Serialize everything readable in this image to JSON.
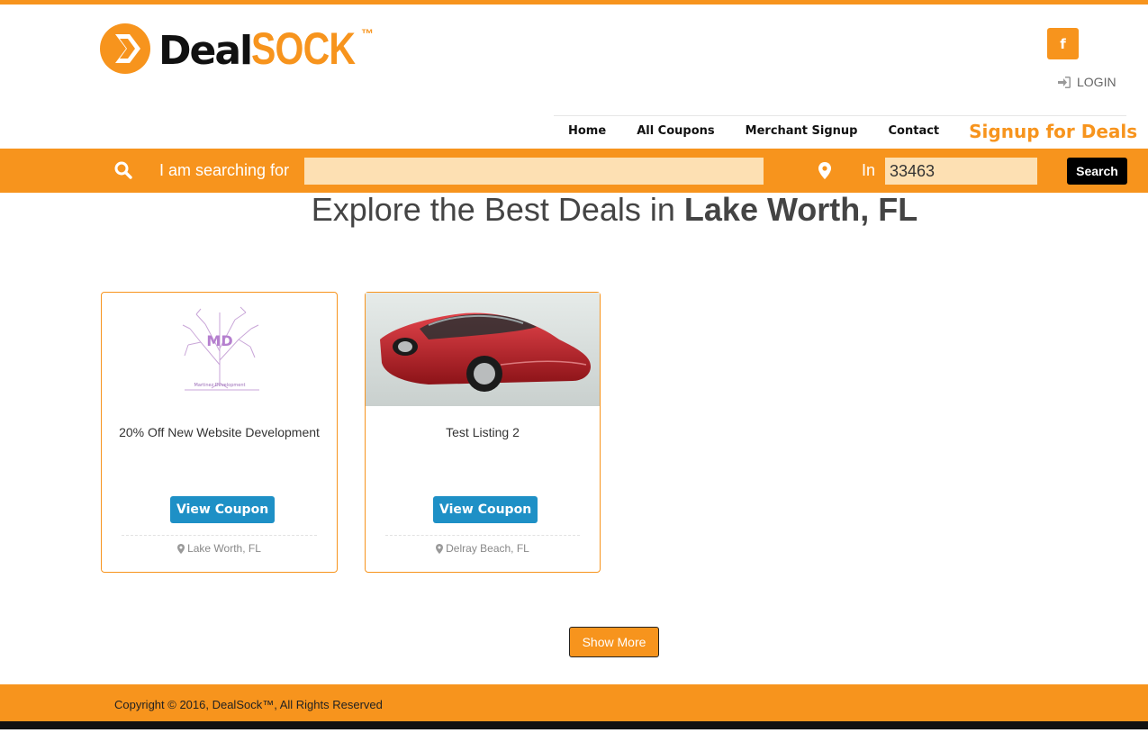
{
  "brand": {
    "name_part1": "Deal",
    "name_part2": "SOCK",
    "trademark": "™"
  },
  "header": {
    "social_facebook": "f",
    "login_label": "LOGIN"
  },
  "nav": {
    "items": [
      "Home",
      "All Coupons",
      "Merchant Signup",
      "Contact"
    ],
    "cta": "Signup for Deals"
  },
  "search": {
    "label": "I am searching for",
    "query": "",
    "in_label": "In",
    "zip": "33463",
    "button": "Search"
  },
  "headline": {
    "prefix": "Explore the Best Deals in ",
    "location": "Lake Worth, FL"
  },
  "listings": [
    {
      "title": "20% Off New Website Development",
      "logo_initials": "MD",
      "logo_caption": "Martinez Development",
      "button": "View Coupon",
      "location": "Lake Worth, FL"
    },
    {
      "title": "Test Listing 2",
      "button": "View Coupon",
      "location": "Delray Beach, FL"
    }
  ],
  "show_more": "Show More",
  "footer": {
    "copyright": "Copyright © 2016, DealSock™, All Rights Reserved"
  },
  "colors": {
    "brand_orange": "#f7941d",
    "input_bg": "#fde0b3",
    "coupon_blue": "#1e90c6",
    "dark": "#111111"
  }
}
